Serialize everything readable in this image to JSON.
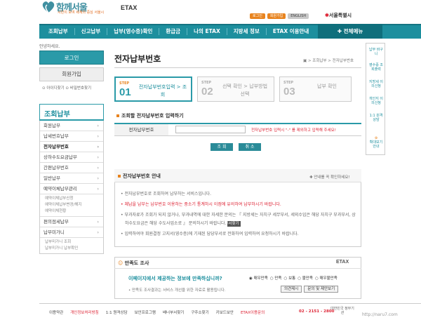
{
  "header": {
    "logo_text": "함께서울",
    "logo_sub": "시민이 모여 세계의 중심 서울시",
    "logo_etax": "ETAX",
    "top_buttons": [
      "로그인",
      "회원가입",
      "ENGLISH"
    ],
    "seoul_label": "서울특별시"
  },
  "nav": {
    "items": [
      "조회납부",
      "신고납부",
      "납부(영수증)확인",
      "환급금",
      "나의 ETAX",
      "지방세 정보",
      "ETAX 이용안내"
    ],
    "all_menu": "✚ 전체메뉴"
  },
  "greeting": "안녕하세요.",
  "login": {
    "login_label": "로그인",
    "join_label": "회원가입",
    "find_label": "⊙ 아이디찾기  ⊙ 비밀번호찾기"
  },
  "left_menu": {
    "title": "조회납부",
    "items": [
      "회원납부",
      "납세번호납부",
      "전자납부번호",
      "상하수도요금납부",
      "간편납부번호",
      "일반납부",
      "예약이체납부관리"
    ],
    "subs": [
      "예약이체납부신청",
      "예약이체납부변경/해지",
      "예약이체현황"
    ],
    "items2": [
      "편의점세납부",
      "납부미가니"
    ],
    "subs2": [
      "납부미가니 조회",
      "납부미가니 납부확인"
    ]
  },
  "main": {
    "title": "전자납부번호",
    "breadcrumb": "▣ > 조회납부 > 전자납부번호",
    "steps": [
      {
        "label": "STEP",
        "num": "01",
        "text": "전자납부번호입력 > 조회"
      },
      {
        "label": "STEP",
        "num": "02",
        "text": "선택 확인 > 납부방법 선택"
      },
      {
        "label": "STEP",
        "num": "03",
        "text": "납부 확인"
      }
    ],
    "section_title": "조회할 전자납부번호 입력하기",
    "form_label": "전자납부번호",
    "form_note": "전자납부번호 입력시 \"-\" 를 제외하고 입력해 주세요!",
    "btn_search": "조 회",
    "btn_cancel": "취 소"
  },
  "guide": {
    "title": "전자납부번호 안내",
    "more": "✚ 안내를 꼭 확인하세요!",
    "lines": [
      "• 전자납부번호로 조회하여 납부하는 서비스입니다.",
      "• 체납을 납부는 납부번호 이용하는 중소기 통계하시 이점에 유의하여 납부하시기 바랍니다.",
      "• 부과자료가 조회가 되지 않거나, 부과내역에 대한 자세한 문의는 『 지방세는 자치구 세무부서, 세외수입은 해당 자치구 부과부서, 상하수도요금은 해당 수도사업소로 』 문의하시기 바랍니다.",
      "• 입력하여야 회원결정 고지서(영수증)에 기재된 담당부서로 전화하여 입력하여 요청하시기 바랍니다."
    ],
    "print_btn": "부서찾기"
  },
  "survey": {
    "title": "만족도 조사",
    "etax": "ETAX",
    "question": "이페이지에서 제공하는 정보에 만족하십니까?",
    "options": [
      "매우만족",
      "만족",
      "보통",
      "불만족",
      "매우불만족"
    ],
    "note": "• 만족도 조사결과는 서비스 개선을 위한 자료로 활용됩니다.",
    "btn1": "의견제시",
    "btn2": "문의 및 제안보기"
  },
  "quick": [
    "납부 바구니",
    "영수증 조회출력",
    "지방세 이의신청",
    "개인지 이의신청",
    "1:1 원격 상담",
    "확대보기 안내"
  ],
  "footer": {
    "links": [
      "이용약관",
      "개인정보처리방침",
      "1:1 원격상담",
      "보안프로그램",
      "배너부서찾기",
      "구주소찾기",
      "키보드보안",
      "ETAX이용문의"
    ],
    "tel": "02 - 2151 - 2800",
    "right": "대한민국 정부기관",
    "watermark": "http://naru7.com"
  },
  "colors": {
    "primary": "#1d8f9e",
    "accent": "#e8841f",
    "alert": "#dd2233"
  }
}
